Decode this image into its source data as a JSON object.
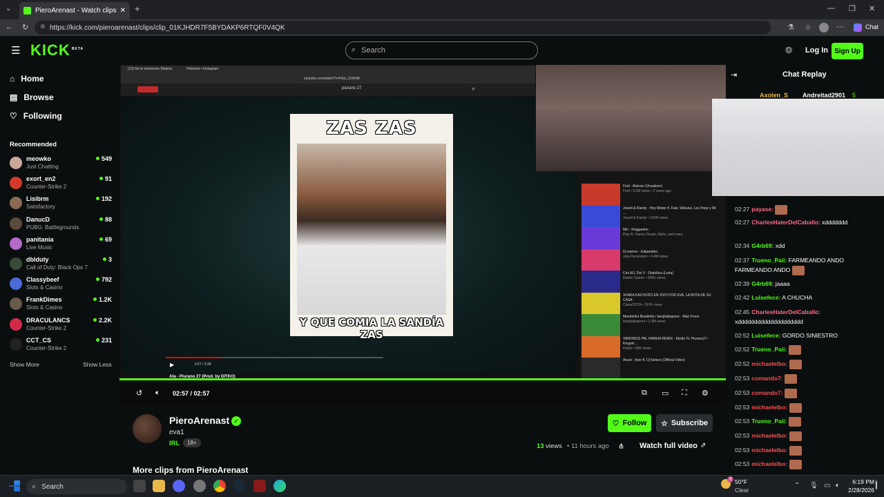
{
  "browser": {
    "tab_title": "PieroArenast - Watch clips on Kick",
    "url": "https://kick.com/pieroarenast/clips/clip_01KJHDR7F5BYDAKP6RTQF0V4QK",
    "chat_button": "Chat"
  },
  "header": {
    "logo": "KICK",
    "logo_badge": "BETA",
    "search_placeholder": "Search",
    "login": "Log In",
    "signup": "Sign Up"
  },
  "sidebar": {
    "nav": [
      {
        "label": "Home",
        "icon": "home-icon"
      },
      {
        "label": "Browse",
        "icon": "browse-icon"
      },
      {
        "label": "Following",
        "icon": "heart-icon"
      }
    ],
    "recommended_title": "Recommended",
    "channels": [
      {
        "name": "meowko",
        "category": "Just Chatting",
        "viewers": "549",
        "color": "#c9a89a"
      },
      {
        "name": "exort_en2",
        "category": "Counter-Strike 2",
        "viewers": "91",
        "color": "#d43a2a"
      },
      {
        "name": "Lisibrm",
        "category": "Satisfactory",
        "viewers": "192",
        "color": "#8a6a52"
      },
      {
        "name": "DanucD",
        "category": "PUBG: Battlegrounds",
        "viewers": "88",
        "color": "#5a4a3a"
      },
      {
        "name": "panitania",
        "category": "Live Music",
        "viewers": "69",
        "color": "#b46ac8"
      },
      {
        "name": "dblduty",
        "category": "Call of Duty: Black Ops 7",
        "viewers": "3",
        "color": "#3a4a3a"
      },
      {
        "name": "Classybeef",
        "category": "Slots & Casino",
        "viewers": "792",
        "color": "#4a6ad8"
      },
      {
        "name": "FrankDimes",
        "category": "Slots & Casino",
        "viewers": "1.2K",
        "color": "#6a5a4a"
      },
      {
        "name": "DRACULANCS",
        "category": "Counter-Strike 2",
        "viewers": "2.2K",
        "color": "#d42a4a"
      },
      {
        "name": "CCT_CS",
        "category": "Counter-Strike 2",
        "viewers": "231",
        "color": "#222222"
      }
    ],
    "show_more": "Show More",
    "show_less": "Show Less"
  },
  "video": {
    "inner_tab_1": "(23) No te enamores Shakira",
    "inner_tab_2": "Historias • Instagram",
    "inner_url": "youtube.com/watch?v=hSw_ZUkhit0",
    "inner_search": "piurano 27",
    "meme_top": "ZAS ZAS",
    "meme_bottom": "Y QUE COMIA LA SANDÍA ZAS",
    "inner_time": "0:27 / 3:34",
    "inner_video_title": "Ata - Piurano 27 (Prod. by DITKO)",
    "time": "02:57 / 02:57",
    "progress": 1.0,
    "yt_suggestions": [
      {
        "title": "Feid - Alakran (Visualizer)",
        "meta": "Feid • 6.5M views • 2 years ago",
        "color": "#c83a2a"
      },
      {
        "title": "Jowell & Randy - Hoy Mister ft. Falo, Watussi, Los Pepe y Mr ...",
        "meta": "Jowell & Randy • 222M views",
        "color": "#3a4ad8"
      },
      {
        "title": "Mix - Reggaeton",
        "meta": "Plan B, Danny Ocean, Myke, and more",
        "color": "#6a3ad8"
      },
      {
        "title": "Dj warner - kulipandeo",
        "meta": "Jota Parrandero • 4.4M views",
        "color": "#d83a6a"
      },
      {
        "title": "Cris MJ, Dei V - Diabólica (Letra)",
        "meta": "Rubén Tauber • 505K views",
        "color": "#2a2a8a"
      },
      {
        "title": "SHAKA KACHUDO EN VIVO POR EVA, LA BOTA DE SU CASA",
        "meta": "ChinaOOTA • 187K views",
        "color": "#d8c82a"
      },
      {
        "title": "Mambinho Brasileño / benjitalkapone - Mari Froes",
        "meta": "benjitalkapone • 3.3M views",
        "color": "#3a8a3a"
      },
      {
        "title": "VAMONOS PAL HAREM REMIX - Kleiito Ft. Piurano27 - Kingski ...",
        "meta": "Kleiito • 89K views",
        "color": "#d86a2a"
      },
      {
        "title": "Anuel - Ayer ft. Dj Nelson (Official Video)",
        "meta": "",
        "color": "#2a2a2a"
      }
    ]
  },
  "chat": {
    "title": "Chat Replay",
    "top_users": [
      "Axolen_S",
      "Andreitad2901",
      "5"
    ],
    "messages": [
      {
        "time": "02:27",
        "user": "payase:",
        "color": "#ff6b8a",
        "text": "",
        "emote": true
      },
      {
        "time": "02:27",
        "user": "CharlesHaterDelCaballo",
        "color": "#ff6b8a",
        "text": ": xddddddd",
        "emote": false
      },
      {
        "time": "02:34",
        "user": "G4rb69:",
        "color": "#53fc18",
        "text": " xdd",
        "emote": false
      },
      {
        "time": "02:37",
        "user": "Trueno_Paii:",
        "color": "#53fc18",
        "text": " FARMEANDO ANDO FARMEANDO ANDO",
        "emote": true
      },
      {
        "time": "02:39",
        "user": "G4rb69:",
        "color": "#53fc18",
        "text": " jaaaa",
        "emote": false
      },
      {
        "time": "02:42",
        "user": "Luisefece:",
        "color": "#53fc18",
        "text": " A CHUCHA",
        "emote": false
      },
      {
        "time": "02:45",
        "user": "CharlesHaterDelCaballo",
        "color": "#ff6b8a",
        "text": ": xdddddddddddddddddddd",
        "emote": false
      },
      {
        "time": "02:52",
        "user": "Luisefece:",
        "color": "#53fc18",
        "text": " GORDO SINIESTRO",
        "emote": false
      },
      {
        "time": "02:52",
        "user": "Trueno_Paii:",
        "color": "#53fc18",
        "text": "",
        "emote": true
      },
      {
        "time": "02:52",
        "user": "michaelelbo:",
        "color": "#ff4d4d",
        "text": "",
        "emote": true
      },
      {
        "time": "02:53",
        "user": "comando7:",
        "color": "#ff4d4d",
        "text": "",
        "emote": true
      },
      {
        "time": "02:53",
        "user": "comando7:",
        "color": "#ff4d4d",
        "text": "",
        "emote": true
      },
      {
        "time": "02:53",
        "user": "michaelelbo:",
        "color": "#ff4d4d",
        "text": "",
        "emote": true
      },
      {
        "time": "02:53",
        "user": "Trueno_Paii:",
        "color": "#53fc18",
        "text": "",
        "emote": true
      },
      {
        "time": "02:53",
        "user": "michaelelbo:",
        "color": "#ff4d4d",
        "text": "",
        "emote": true
      },
      {
        "time": "02:53",
        "user": "michaelelbo:",
        "color": "#ff4d4d",
        "text": "",
        "emote": true
      },
      {
        "time": "02:53",
        "user": "michaelelbo:",
        "color": "#ff4d4d",
        "text": "",
        "emote": true
      }
    ]
  },
  "clip": {
    "channel": "PieroArenast",
    "title": "eva1",
    "category": "IRL",
    "rating": "18+",
    "follow": "Follow",
    "subscribe": "Subscribe",
    "views_count": "13",
    "views_label": "views",
    "age": "• 11 hours ago",
    "watch_full": "Watch full video",
    "more_clips": "More clips from PieroArenast"
  },
  "taskbar": {
    "search": "Search",
    "temp": "50°F",
    "weather": "Clear",
    "time": "6:19 PM",
    "date": "2/28/2026",
    "weather_badge": "3"
  },
  "colors": {
    "accent": "#53fc18",
    "bg": "#0b0e0f"
  }
}
